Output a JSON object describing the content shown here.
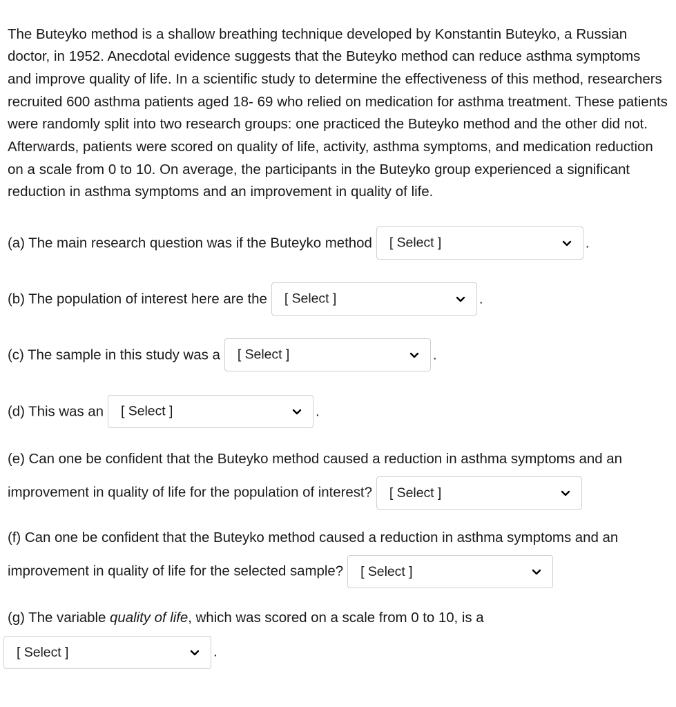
{
  "document": {
    "intro_paragraph": "The Buteyko method is a shallow breathing technique developed by Konstantin Buteyko, a Russian doctor, in 1952. Anecdotal evidence suggests that the Buteyko method can reduce asthma symptoms and improve quality of life. In a scientific study to determine the effectiveness of this method, researchers recruited 600 asthma patients aged 18- 69 who relied on medication for asthma treatment. These patients were randomly split into two research groups: one practiced the Buteyko method and the other did not. Afterwards, patients were scored on quality of life, activity, asthma symptoms, and medication reduction on a scale from 0 to 10. On average, the participants in the Buteyko group experienced a significant reduction in asthma symptoms and an improvement in quality of life."
  },
  "select_placeholder": "[ Select ]",
  "period": ".",
  "questions": {
    "a": {
      "label": "(a) The main research question was if the Buteyko method",
      "select_value": "[ Select ]"
    },
    "b": {
      "label": "(b) The population of interest here are the",
      "select_value": "[ Select ]"
    },
    "c": {
      "label": "(c) The sample in this study was a",
      "select_value": "[ Select ]"
    },
    "d": {
      "label": "(d) This was an",
      "select_value": "[ Select ]"
    },
    "e": {
      "line1": "(e) Can one be confident that the Buteyko method caused a reduction in asthma symptoms and an",
      "line2": "improvement in quality of life for the population of interest?",
      "select_value": "[ Select ]"
    },
    "f": {
      "line1": "(f) Can one be confident that the Buteyko method caused a reduction in asthma symptoms and an",
      "line2": "improvement in quality of life for the selected sample?",
      "select_value": "[ Select ]"
    },
    "g": {
      "line1_pre": "(g) The variable ",
      "line1_italic": "quality of life",
      "line1_post": ", which was scored on a scale from 0 to 10, is a",
      "select_value": "[ Select ]"
    }
  },
  "colors": {
    "background": "#ffffff",
    "text": "#1a1a1a",
    "select_border": "#cfcfcf",
    "select_background": "#ffffff"
  },
  "icons": {
    "chevron_down": "chevron-down-icon"
  }
}
